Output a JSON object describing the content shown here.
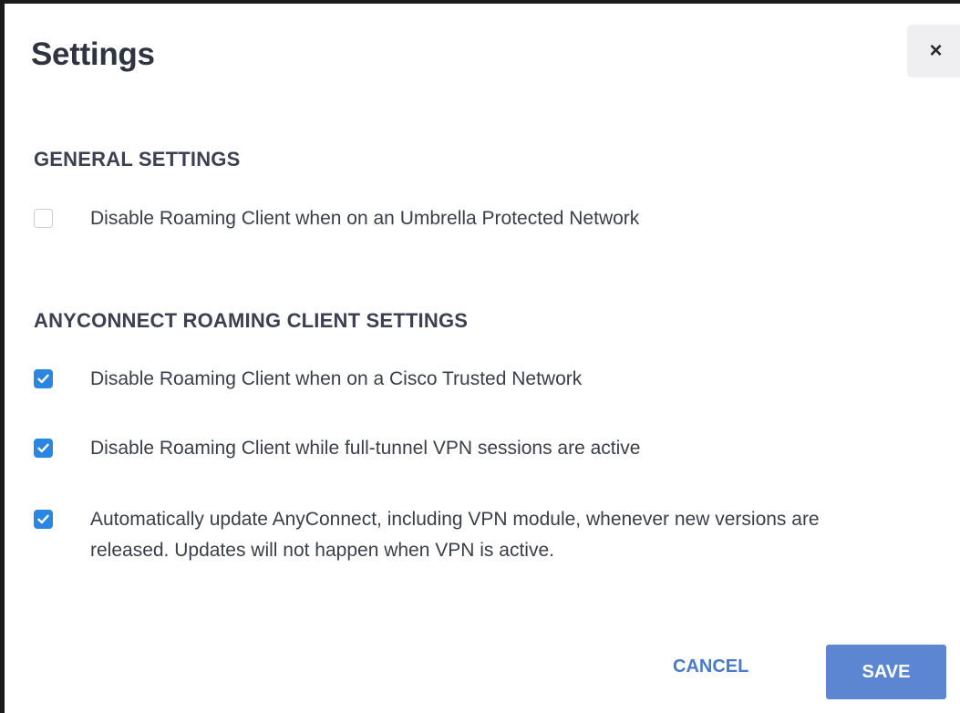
{
  "dialog": {
    "title": "Settings",
    "close_label": "×"
  },
  "general": {
    "heading": "GENERAL SETTINGS",
    "options": [
      {
        "label": "Disable Roaming Client when on an Umbrella Protected Network",
        "checked": false
      }
    ]
  },
  "anyconnect": {
    "heading": "ANYCONNECT ROAMING CLIENT SETTINGS",
    "options": [
      {
        "label": "Disable Roaming Client when on a Cisco Trusted Network",
        "checked": true
      },
      {
        "label": "Disable Roaming Client while full-tunnel VPN sessions are active",
        "checked": true
      },
      {
        "label": "Automatically update AnyConnect, including VPN module, whenever new versions are released. Updates will not happen when VPN is active.",
        "checked": true
      }
    ]
  },
  "footer": {
    "cancel_label": "CANCEL",
    "save_label": "SAVE"
  },
  "colors": {
    "checkbox_checked": "#2b86e1",
    "save_button": "#5c86d2",
    "cancel_text": "#4a7ac8"
  },
  "icons": {
    "close": "close-icon",
    "check": "checkmark-icon"
  }
}
